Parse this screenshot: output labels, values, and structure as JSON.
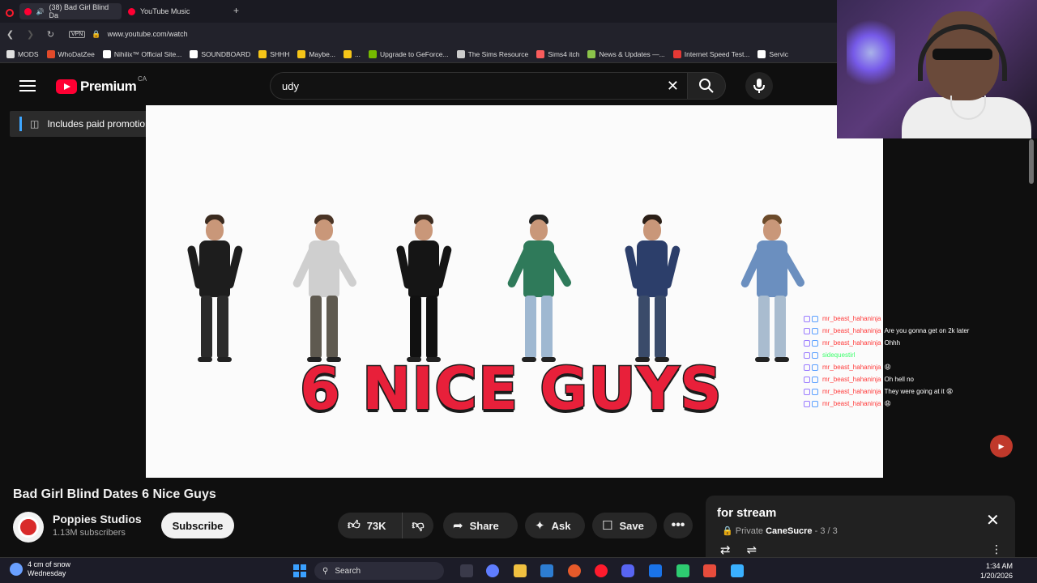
{
  "browser": {
    "tabs": [
      {
        "label": "(38) Bad Girl Blind Da"
      },
      {
        "label": "YouTube Music"
      }
    ],
    "new_tab": "+",
    "vpn_label": "VPN",
    "url": "www.youtube.com/watch",
    "bookmarks": [
      {
        "label": "MODS",
        "icon": "folder-icon",
        "color": "#e0e0e0"
      },
      {
        "label": "WhoDatZee",
        "icon": "app-icon",
        "color": "#e24a2a"
      },
      {
        "label": "Nihilix™ Official Site...",
        "icon": "page-icon",
        "color": "#ffffff"
      },
      {
        "label": "SOUNDBOARD",
        "icon": "page-icon",
        "color": "#ffffff"
      },
      {
        "label": "SHHH",
        "icon": "star-icon",
        "color": "#f5c518"
      },
      {
        "label": "Maybe...",
        "icon": "star-icon",
        "color": "#f5c518"
      },
      {
        "label": "...",
        "icon": "star-icon",
        "color": "#f5c518"
      },
      {
        "label": "Upgrade to GeForce...",
        "icon": "nvidia-icon",
        "color": "#76b900"
      },
      {
        "label": "The Sims Resource",
        "icon": "tsr-icon",
        "color": "#cccccc"
      },
      {
        "label": "Sims4 itch",
        "icon": "itch-icon",
        "color": "#fa5c5c"
      },
      {
        "label": "News & Updates —...",
        "icon": "page-icon",
        "color": "#8bc34a"
      },
      {
        "label": "Internet Speed Test...",
        "icon": "speed-icon",
        "color": "#e53935"
      },
      {
        "label": "Servic",
        "icon": "page-icon",
        "color": "#ffffff"
      }
    ]
  },
  "youtube": {
    "logo_text": "Premium",
    "region": "CA",
    "search_value": "udy",
    "brand_color": "#ff0033"
  },
  "promo": {
    "label": "Includes paid promotion"
  },
  "video": {
    "overlay_title": "6 NICE GUYS",
    "title": "Bad Girl Blind Dates 6 Nice Guys",
    "channel": "Poppies Studios",
    "subscribers": "1.13M subscribers",
    "subscribe_label": "Subscribe",
    "likes": "73K",
    "share_label": "Share",
    "ask_label": "Ask",
    "save_label": "Save"
  },
  "chat": [
    {
      "user": "mr_beast_hahaninja",
      "msg": "",
      "color": "red"
    },
    {
      "user": "mr_beast_hahaninja",
      "msg": "Are you gonna get on 2k later",
      "color": "red"
    },
    {
      "user": "mr_beast_hahaninja",
      "msg": "Ohhh",
      "color": "red"
    },
    {
      "user": "sidequestirl",
      "msg": "",
      "color": "green"
    },
    {
      "user": "mr_beast_hahaninja",
      "msg": "😩",
      "color": "red"
    },
    {
      "user": "mr_beast_hahaninja",
      "msg": "Oh hell no",
      "color": "red"
    },
    {
      "user": "mr_beast_hahaninja",
      "msg": "They were going at it 😩",
      "color": "red"
    },
    {
      "user": "mr_beast_hahaninja",
      "msg": "😩",
      "color": "red"
    }
  ],
  "playlist": {
    "title": "for stream",
    "privacy": "Private",
    "owner": "CaneSucre",
    "position": "- 3 / 3"
  },
  "taskbar": {
    "weather_line1": "4 cm of snow",
    "weather_line2": "Wednesday",
    "search_label": "Search",
    "time": "1:34 AM",
    "date": "1/20/2026"
  }
}
